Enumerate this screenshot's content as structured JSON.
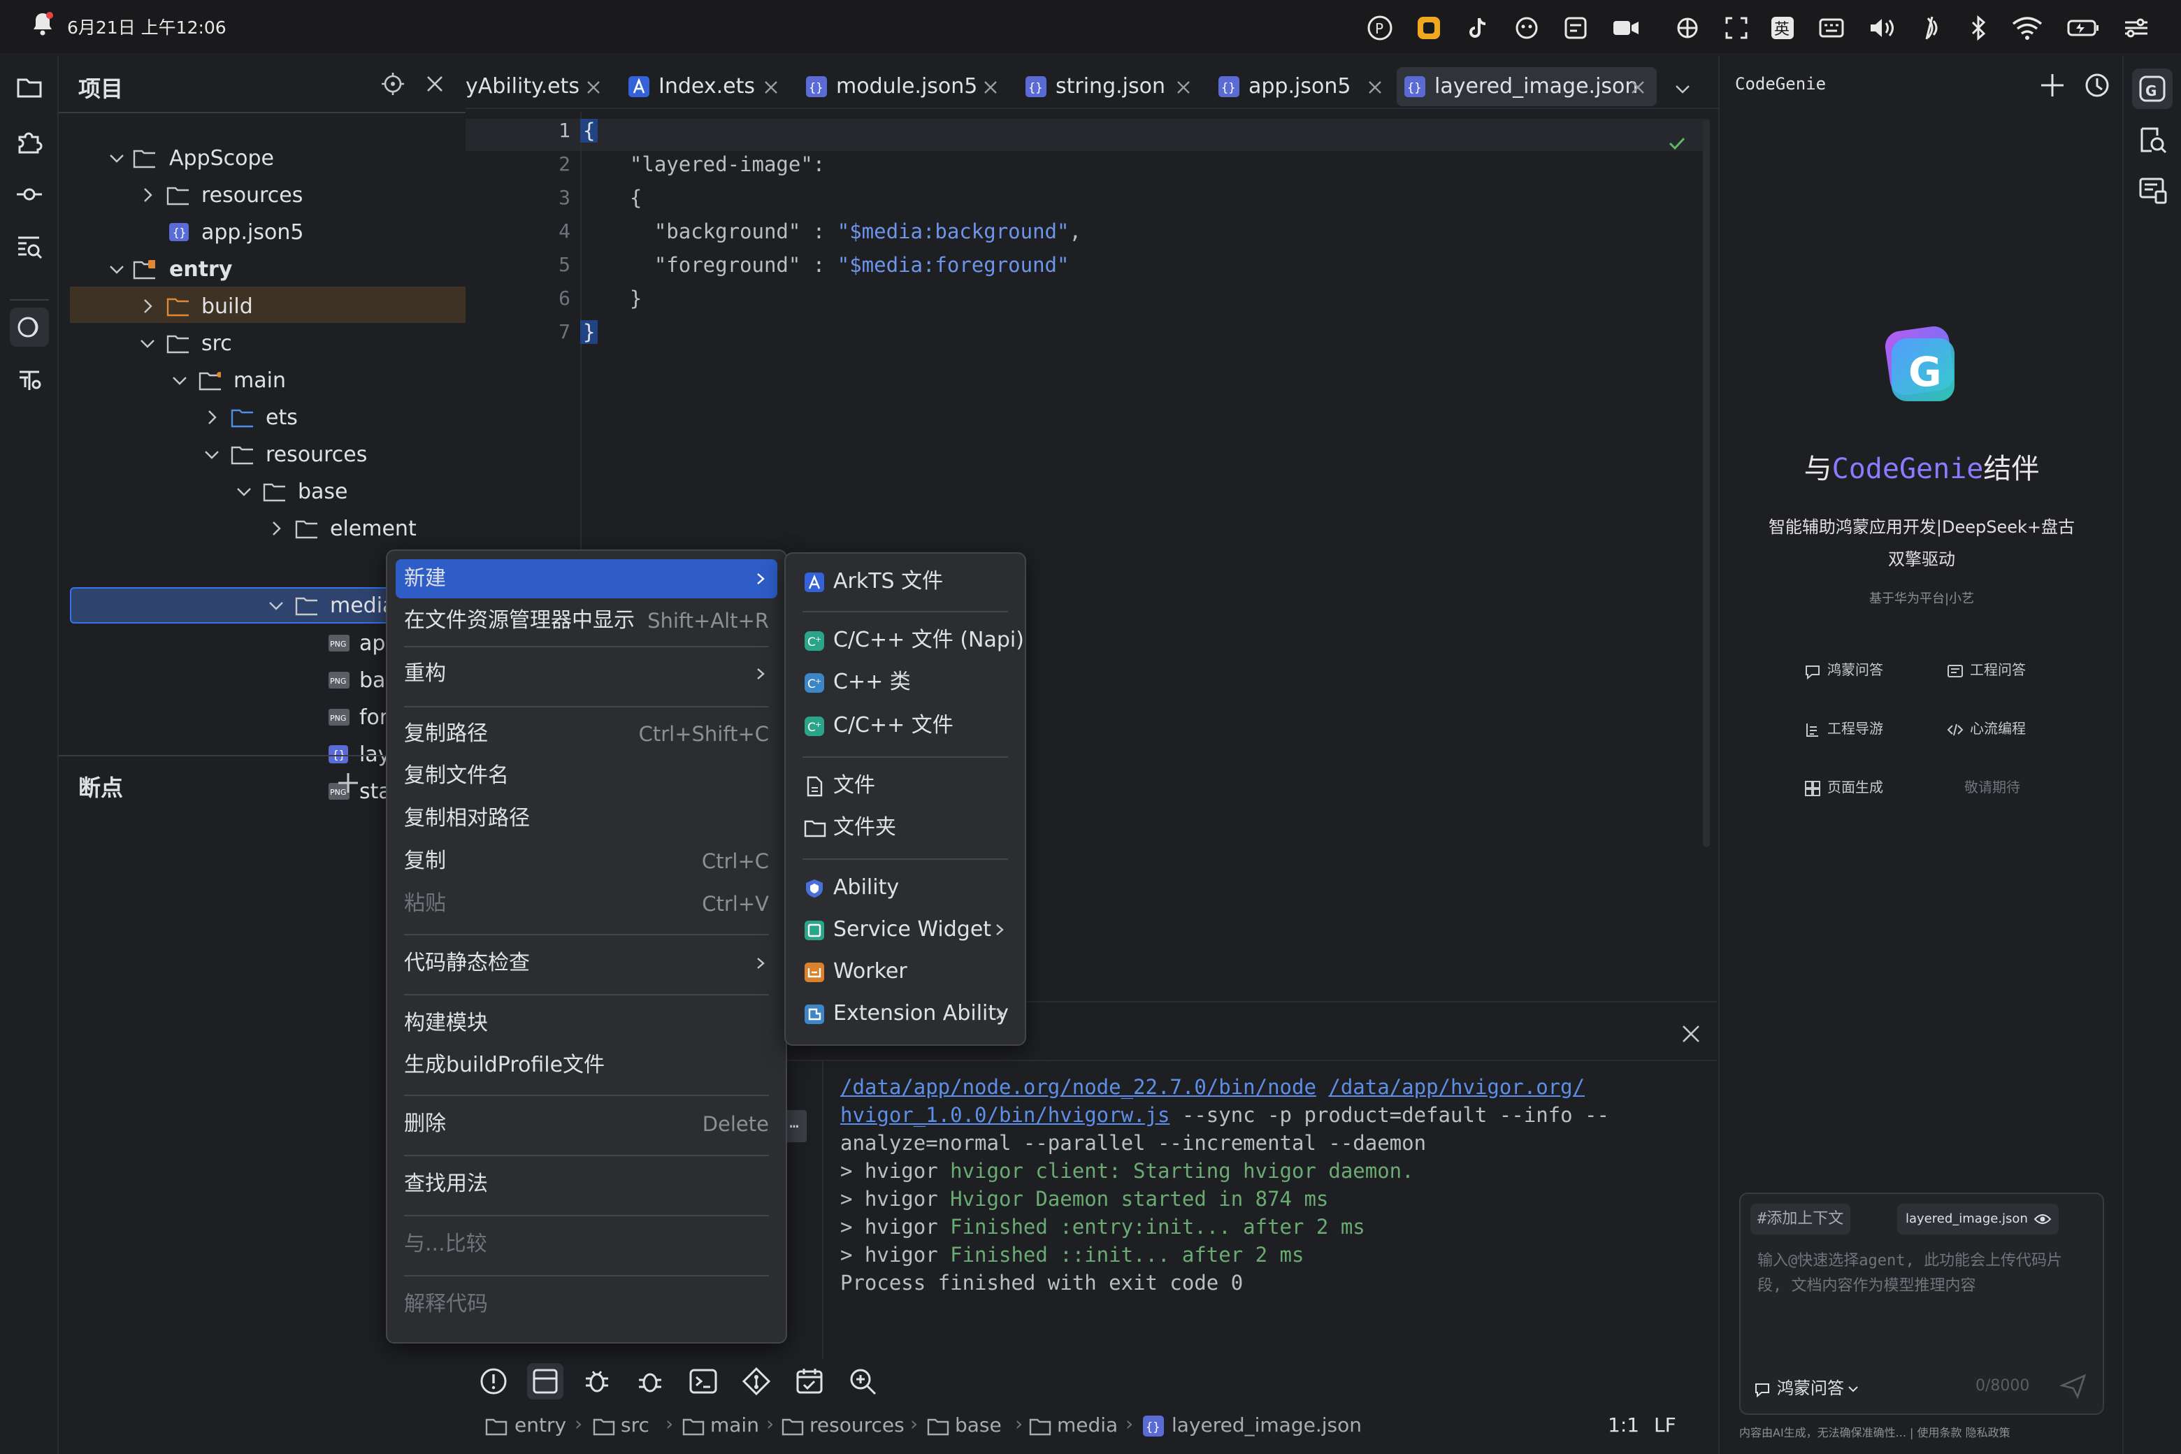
{
  "status_bar": {
    "time": "6月21日 上午12:06"
  },
  "project_panel": {
    "title": "项目",
    "tree": [
      {
        "label": "AppScope",
        "type": "folder",
        "expanded": true
      },
      {
        "label": "resources",
        "type": "folder",
        "expanded": false
      },
      {
        "label": "app.json5",
        "type": "json"
      },
      {
        "label": "entry",
        "type": "module",
        "expanded": true
      },
      {
        "label": "build",
        "type": "folder-orange",
        "expanded": false
      },
      {
        "label": "src",
        "type": "folder",
        "expanded": true
      },
      {
        "label": "main",
        "type": "folder",
        "expanded": true
      },
      {
        "label": "ets",
        "type": "folder-blue",
        "expanded": false
      },
      {
        "label": "resources",
        "type": "folder",
        "expanded": true
      },
      {
        "label": "base",
        "type": "folder",
        "expanded": true
      },
      {
        "label": "element",
        "type": "folder",
        "expanded": false
      },
      {
        "label": "media",
        "type": "folder",
        "expanded": true
      },
      {
        "label": "ap",
        "type": "png"
      },
      {
        "label": "ba",
        "type": "png"
      },
      {
        "label": "for",
        "type": "png"
      },
      {
        "label": "lay",
        "type": "json"
      },
      {
        "label": "sta",
        "type": "png"
      }
    ],
    "breakpoints_title": "断点"
  },
  "tabs": [
    {
      "label": "yAbility.ets",
      "icon": "file-icon"
    },
    {
      "label": "Index.ets",
      "icon": "arkts-icon"
    },
    {
      "label": "module.json5",
      "icon": "json-icon"
    },
    {
      "label": "string.json",
      "icon": "json-icon"
    },
    {
      "label": "app.json5",
      "icon": "json-icon"
    },
    {
      "label": "layered_image.json",
      "icon": "json-icon",
      "active": true
    }
  ],
  "editor": {
    "line_numbers": [
      "1",
      "2",
      "3",
      "4",
      "5",
      "6",
      "7"
    ],
    "lines": [
      [
        "{"
      ],
      [
        "  \"layered-image\":"
      ],
      [
        "  {"
      ],
      [
        "    \"background\" : ",
        "\"$media:background\"",
        ","
      ],
      [
        "    \"foreground\" : ",
        "\"$media:foreground\""
      ],
      [
        "  }"
      ],
      [
        "}"
      ]
    ]
  },
  "context_menu": {
    "items": [
      {
        "label": "新建",
        "shortcut": "",
        "submenu": true
      },
      {
        "label": "在文件资源管理器中显示",
        "shortcut": "Shift+Alt+R"
      },
      {
        "label": "重构",
        "shortcut": "",
        "submenu": true
      },
      {
        "label": "复制路径",
        "shortcut": "Ctrl+Shift+C"
      },
      {
        "label": "复制文件名",
        "shortcut": ""
      },
      {
        "label": "复制相对路径",
        "shortcut": ""
      },
      {
        "label": "复制",
        "shortcut": "Ctrl+C"
      },
      {
        "label": "粘贴",
        "shortcut": "Ctrl+V",
        "disabled": true
      },
      {
        "label": "代码静态检查",
        "shortcut": "",
        "submenu": true
      },
      {
        "label": "构建模块",
        "shortcut": ""
      },
      {
        "label": "生成buildProfile文件",
        "shortcut": ""
      },
      {
        "label": "删除",
        "shortcut": "Delete"
      },
      {
        "label": "查找用法",
        "shortcut": ""
      },
      {
        "label": "与...比较",
        "shortcut": "",
        "disabled": true
      },
      {
        "label": "解释代码",
        "shortcut": "",
        "disabled": true
      }
    ]
  },
  "submenu": {
    "items": [
      {
        "label": "ArkTS 文件",
        "icon": "arkts-icon"
      },
      {
        "label": "C/C++ 文件 (Napi)",
        "icon": "cpp-icon"
      },
      {
        "label": "C++ 类",
        "icon": "cpp-class-icon"
      },
      {
        "label": "C/C++ 文件",
        "icon": "cpp-icon"
      },
      {
        "label": "文件",
        "icon": "file-icon"
      },
      {
        "label": "文件夹",
        "icon": "folder-icon"
      },
      {
        "label": "Ability",
        "icon": "ability-icon"
      },
      {
        "label": "Service Widget",
        "icon": "widget-icon",
        "submenu": true
      },
      {
        "label": "Worker",
        "icon": "worker-icon"
      },
      {
        "label": "Extension Ability",
        "icon": "extension-icon",
        "submenu": true
      }
    ]
  },
  "console": {
    "line1a": "/data/app/node.org/node_22.7.0/bin/node",
    "line1b": "/data/app/hvigor.org/",
    "line2a": "hvigor_1.0.0/bin/hvigorw.js",
    "line2b": " --sync -p product=default --info --",
    "line3": "analyze=normal --parallel --incremental --daemon",
    "line4a": "> hvigor ",
    "line4b": "hvigor client: Starting hvigor daemon.",
    "line5a": "> hvigor ",
    "line5b": "Hvigor Daemon started in 874 ms",
    "line6a": "> hvigor ",
    "line6b": "Finished :entry:init... after 2 ms",
    "line7a": "> hvigor ",
    "line7b": "Finished ::init... after 2 ms",
    "line8": "Process finished with exit code 0"
  },
  "breadcrumbs": [
    "entry",
    "src",
    "main",
    "resources",
    "base",
    "media",
    "layered_image.json"
  ],
  "cursor": {
    "position": "1:1",
    "line_ending": "LF"
  },
  "codegenie": {
    "title": "CodeGenie",
    "heading_prefix": "与",
    "heading_brand": "CodeGenie",
    "heading_suffix": "结伴",
    "subtitle_line1": "智能辅助鸿蒙应用开发|DeepSeek+盘古",
    "subtitle_line2": "双擎驱动",
    "small": "基于华为平台|小艺",
    "features": [
      "鸿蒙问答",
      "工程问答",
      "工程导游",
      "心流编程",
      "页面生成",
      "敬请期待"
    ],
    "add_context": "#添加上下文",
    "file_chip": "layered_image.json",
    "placeholder": "输入@快速选择agent, 此功能会上传代码片段, 文档内容作为模型推理内容",
    "mode": "鸿蒙问答",
    "counter": "0/8000",
    "footer": "内容由AI生成，无法确保准确性... | 使用条款 隐私政策"
  },
  "colors": {
    "accent": "#3574f0",
    "selection": "#2e436e",
    "string": "#6c95eb",
    "green": "#6aab73"
  }
}
